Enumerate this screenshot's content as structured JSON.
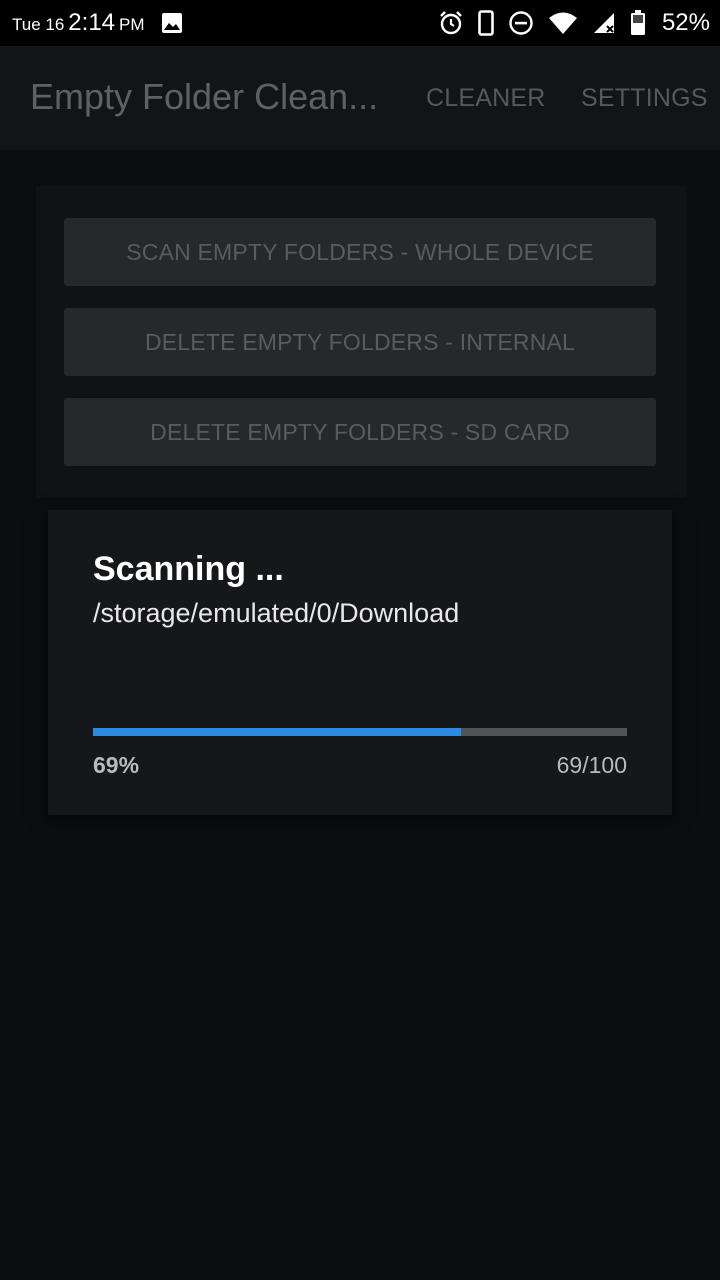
{
  "status_bar": {
    "day": "Tue 16",
    "time": "2:14",
    "ampm": "PM",
    "battery_percent": "52%",
    "icons": [
      "image-icon",
      "alarm-icon",
      "phone-icon",
      "dnd-icon",
      "wifi-icon",
      "signal-icon",
      "battery-icon"
    ]
  },
  "appbar": {
    "title": "Empty Folder Clean...",
    "tabs": [
      "CLEANER",
      "SETTINGS"
    ]
  },
  "actions": [
    "SCAN EMPTY FOLDERS - WHOLE DEVICE",
    "DELETE EMPTY FOLDERS - INTERNAL",
    "DELETE EMPTY FOLDERS - SD CARD"
  ],
  "dialog": {
    "title": "Scanning ...",
    "path": "/storage/emulated/0/Download",
    "progress_fraction": 0.69,
    "progress_percent_label": "69%",
    "progress_count_label": "69/100"
  },
  "colors": {
    "progress_fill": "#2b8be0",
    "progress_track": "#525357",
    "background": "#0c0d10",
    "dialog": "#16171a"
  }
}
